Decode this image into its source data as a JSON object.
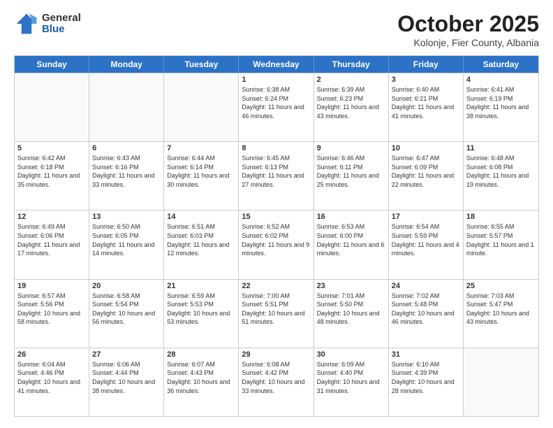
{
  "logo": {
    "general": "General",
    "blue": "Blue"
  },
  "header": {
    "month": "October 2025",
    "location": "Kolonje, Fier County, Albania"
  },
  "days": [
    "Sunday",
    "Monday",
    "Tuesday",
    "Wednesday",
    "Thursday",
    "Friday",
    "Saturday"
  ],
  "weeks": [
    [
      {
        "day": "",
        "empty": true
      },
      {
        "day": "",
        "empty": true
      },
      {
        "day": "",
        "empty": true
      },
      {
        "day": "1",
        "sunrise": "6:38 AM",
        "sunset": "6:24 PM",
        "daylight": "11 hours and 46 minutes."
      },
      {
        "day": "2",
        "sunrise": "6:39 AM",
        "sunset": "6:23 PM",
        "daylight": "11 hours and 43 minutes."
      },
      {
        "day": "3",
        "sunrise": "6:40 AM",
        "sunset": "6:21 PM",
        "daylight": "11 hours and 41 minutes."
      },
      {
        "day": "4",
        "sunrise": "6:41 AM",
        "sunset": "6:19 PM",
        "daylight": "11 hours and 38 minutes."
      }
    ],
    [
      {
        "day": "5",
        "sunrise": "6:42 AM",
        "sunset": "6:18 PM",
        "daylight": "11 hours and 35 minutes."
      },
      {
        "day": "6",
        "sunrise": "6:43 AM",
        "sunset": "6:16 PM",
        "daylight": "11 hours and 33 minutes."
      },
      {
        "day": "7",
        "sunrise": "6:44 AM",
        "sunset": "6:14 PM",
        "daylight": "11 hours and 30 minutes."
      },
      {
        "day": "8",
        "sunrise": "6:45 AM",
        "sunset": "6:13 PM",
        "daylight": "11 hours and 27 minutes."
      },
      {
        "day": "9",
        "sunrise": "6:46 AM",
        "sunset": "6:11 PM",
        "daylight": "11 hours and 25 minutes."
      },
      {
        "day": "10",
        "sunrise": "6:47 AM",
        "sunset": "6:09 PM",
        "daylight": "11 hours and 22 minutes."
      },
      {
        "day": "11",
        "sunrise": "6:48 AM",
        "sunset": "6:08 PM",
        "daylight": "11 hours and 19 minutes."
      }
    ],
    [
      {
        "day": "12",
        "sunrise": "6:49 AM",
        "sunset": "6:06 PM",
        "daylight": "11 hours and 17 minutes."
      },
      {
        "day": "13",
        "sunrise": "6:50 AM",
        "sunset": "6:05 PM",
        "daylight": "11 hours and 14 minutes."
      },
      {
        "day": "14",
        "sunrise": "6:51 AM",
        "sunset": "6:03 PM",
        "daylight": "11 hours and 12 minutes."
      },
      {
        "day": "15",
        "sunrise": "6:52 AM",
        "sunset": "6:02 PM",
        "daylight": "11 hours and 9 minutes."
      },
      {
        "day": "16",
        "sunrise": "6:53 AM",
        "sunset": "6:00 PM",
        "daylight": "11 hours and 6 minutes."
      },
      {
        "day": "17",
        "sunrise": "6:54 AM",
        "sunset": "5:59 PM",
        "daylight": "11 hours and 4 minutes."
      },
      {
        "day": "18",
        "sunrise": "6:55 AM",
        "sunset": "5:57 PM",
        "daylight": "11 hours and 1 minute."
      }
    ],
    [
      {
        "day": "19",
        "sunrise": "6:57 AM",
        "sunset": "5:56 PM",
        "daylight": "10 hours and 58 minutes."
      },
      {
        "day": "20",
        "sunrise": "6:58 AM",
        "sunset": "5:54 PM",
        "daylight": "10 hours and 56 minutes."
      },
      {
        "day": "21",
        "sunrise": "6:59 AM",
        "sunset": "5:53 PM",
        "daylight": "10 hours and 53 minutes."
      },
      {
        "day": "22",
        "sunrise": "7:00 AM",
        "sunset": "5:51 PM",
        "daylight": "10 hours and 51 minutes."
      },
      {
        "day": "23",
        "sunrise": "7:01 AM",
        "sunset": "5:50 PM",
        "daylight": "10 hours and 48 minutes."
      },
      {
        "day": "24",
        "sunrise": "7:02 AM",
        "sunset": "5:48 PM",
        "daylight": "10 hours and 46 minutes."
      },
      {
        "day": "25",
        "sunrise": "7:03 AM",
        "sunset": "5:47 PM",
        "daylight": "10 hours and 43 minutes."
      }
    ],
    [
      {
        "day": "26",
        "sunrise": "6:04 AM",
        "sunset": "4:46 PM",
        "daylight": "10 hours and 41 minutes."
      },
      {
        "day": "27",
        "sunrise": "6:06 AM",
        "sunset": "4:44 PM",
        "daylight": "10 hours and 38 minutes."
      },
      {
        "day": "28",
        "sunrise": "6:07 AM",
        "sunset": "4:43 PM",
        "daylight": "10 hours and 36 minutes."
      },
      {
        "day": "29",
        "sunrise": "6:08 AM",
        "sunset": "4:42 PM",
        "daylight": "10 hours and 33 minutes."
      },
      {
        "day": "30",
        "sunrise": "6:09 AM",
        "sunset": "4:40 PM",
        "daylight": "10 hours and 31 minutes."
      },
      {
        "day": "31",
        "sunrise": "6:10 AM",
        "sunset": "4:39 PM",
        "daylight": "10 hours and 28 minutes."
      },
      {
        "day": "",
        "empty": true
      }
    ]
  ]
}
